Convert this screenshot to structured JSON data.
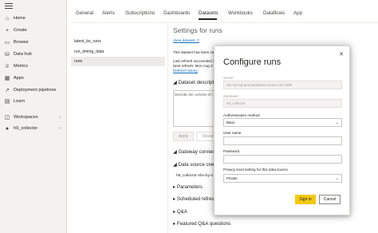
{
  "nav": {
    "items": [
      {
        "label": "Home",
        "icon": "home-icon",
        "glyph": "⌂"
      },
      {
        "label": "Create",
        "icon": "plus-icon",
        "glyph": "+"
      },
      {
        "label": "Browse",
        "icon": "folder-icon",
        "glyph": "▭"
      },
      {
        "label": "Data hub",
        "icon": "cylinder-icon",
        "glyph": "⛁"
      },
      {
        "label": "Metrics",
        "icon": "trophy-icon",
        "glyph": "♕"
      },
      {
        "label": "Apps",
        "icon": "apps-icon",
        "glyph": "▦"
      },
      {
        "label": "Deployment pipelines",
        "icon": "rocket-icon",
        "glyph": "➚"
      },
      {
        "label": "Learn",
        "icon": "book-icon",
        "glyph": "▤"
      },
      {
        "label": "Workspaces",
        "icon": "workspaces-icon",
        "glyph": "◫"
      },
      {
        "label": "h9_collector",
        "icon": "workspace-avatar-icon",
        "glyph": "●"
      }
    ]
  },
  "tabs": [
    "General",
    "Alerts",
    "Subscriptions",
    "Dashboards",
    "Datasets",
    "Workbooks",
    "Dataflows",
    "App"
  ],
  "active_tab": "Datasets",
  "datasets": [
    "latest_bs_runs",
    "run_timing_data",
    "runs"
  ],
  "selected_dataset": "runs",
  "settings": {
    "title": "Settings for runs",
    "view_dataset": "View dataset",
    "info_line": "This dataset has been co",
    "last_refresh": "Last refresh succeeded: M",
    "next_refresh": "Next refresh: Mon Aug 2",
    "refresh_history": "Refresh history",
    "description_header": "Dataset descriptio",
    "description_placeholder": "Describe the contents of t",
    "apply": "Apply",
    "discard": "Discard",
    "sections": [
      "Gateway connecti",
      "Data source crede",
      "Parameters",
      "Scheduled refresh",
      "Q&A",
      "Featured Q&A questions"
    ],
    "gateway_row": "h9_collector-sfa-my-s"
  },
  "modal": {
    "title": "Configure runs",
    "server_label": "server",
    "server_value": "sfa-my-sql-prod.database.azure.com:3306",
    "database_label": "database",
    "database_value": "h9_collector",
    "auth_label": "Authentication method",
    "auth_value": "Basic",
    "username_label": "User name",
    "username_value": "",
    "password_label": "Password",
    "password_value": "",
    "privacy_label": "Privacy level setting for this data source",
    "privacy_value": "Private",
    "signin": "Sign in",
    "cancel": "Cancel"
  },
  "colors": {
    "accent": "#f2c811",
    "link": "#0f6cbd"
  }
}
